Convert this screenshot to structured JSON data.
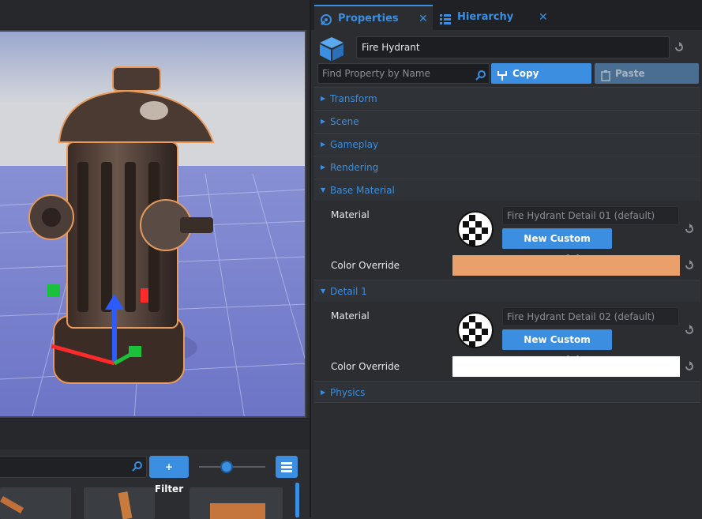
{
  "tabs": [
    {
      "label": "Properties",
      "icon": "properties-icon",
      "close": "✕"
    },
    {
      "label": "Hierarchy",
      "icon": "hierarchy-icon",
      "close": "✕"
    }
  ],
  "object": {
    "icon": "cube-icon",
    "name": "Fire Hydrant"
  },
  "search": {
    "placeholder": "Find Property by Name"
  },
  "buttons": {
    "copy": "Copy Properties",
    "paste": "Paste Properties"
  },
  "sections": {
    "transform": "Transform",
    "scene": "Scene",
    "gameplay": "Gameplay",
    "rendering": "Rendering",
    "base_material": "Base Material",
    "detail1": "Detail 1",
    "physics": "Physics"
  },
  "base_material": {
    "material_label": "Material",
    "material_value": "Fire Hydrant Detail 01 (default)",
    "new_button": "New Custom Material",
    "color_label": "Color Override",
    "color": "#e9a06b"
  },
  "detail1": {
    "material_label": "Material",
    "material_value": "Fire Hydrant Detail 02 (default)",
    "new_button": "New Custom Material",
    "color_label": "Color Override",
    "color": "#ffffff"
  },
  "asset_browser": {
    "filter_label": "+ Filter"
  },
  "colors": {
    "accent": "#3b8ee0",
    "panel": "#2b2d30",
    "viewport_sky": "#7b86c6"
  }
}
